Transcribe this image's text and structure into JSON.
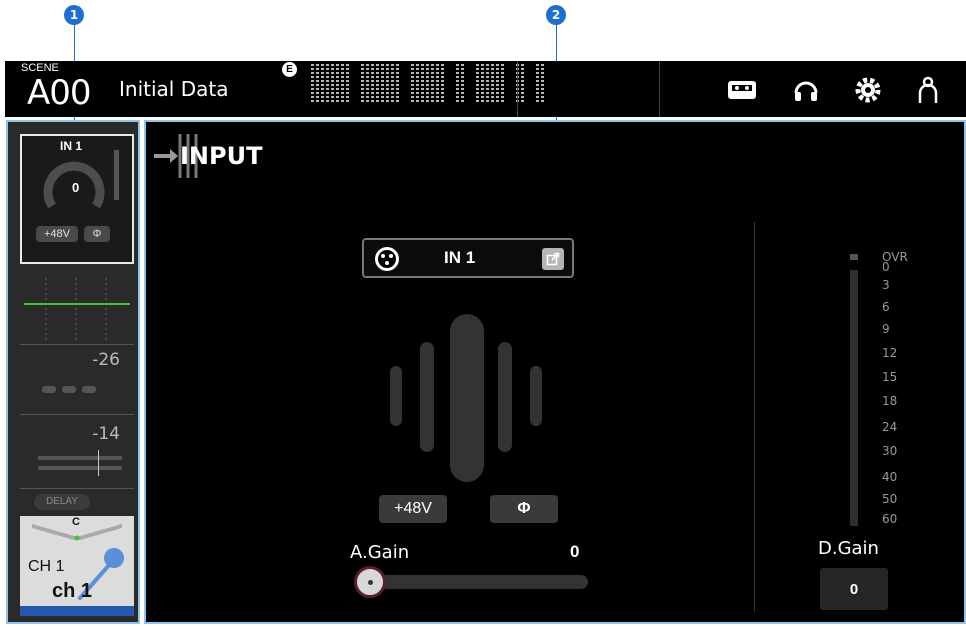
{
  "callouts": [
    "1",
    "2"
  ],
  "header": {
    "scene_tag": "SCENE",
    "scene_number": "A00",
    "scene_name": "Initial Data",
    "edit_badge": "E",
    "icons": [
      "recorder-icon",
      "headphones-icon",
      "settings-gear-icon",
      "user-icon"
    ]
  },
  "strip": {
    "channel": "IN 1",
    "gain_value": "0",
    "phantom_label": "+48V",
    "phase_label": "Φ",
    "gate_threshold": "-26",
    "comp_threshold": "-14",
    "delay_label": "DELAY",
    "pan_label": "C",
    "channel_number": "CH 1",
    "channel_name": "ch 1"
  },
  "main": {
    "title": "INPUT",
    "port_label": "IN 1",
    "phantom_label": "+48V",
    "phase_label": "Φ",
    "analog_gain_label": "A.Gain",
    "analog_gain_value": "0",
    "digital_gain_label": "D.Gain",
    "digital_gain_value": "0",
    "meter_scale": [
      "OVR",
      "0",
      "3",
      "6",
      "9",
      "12",
      "15",
      "18",
      "24",
      "30",
      "40",
      "50",
      "60"
    ]
  },
  "colors": {
    "accent_blue": "#1f6fd1",
    "selection_outline": "#8fc5ea",
    "eq_line": "#48c23a",
    "name_bar": "#2558b0",
    "mic_icon": "#5b8fd8"
  }
}
